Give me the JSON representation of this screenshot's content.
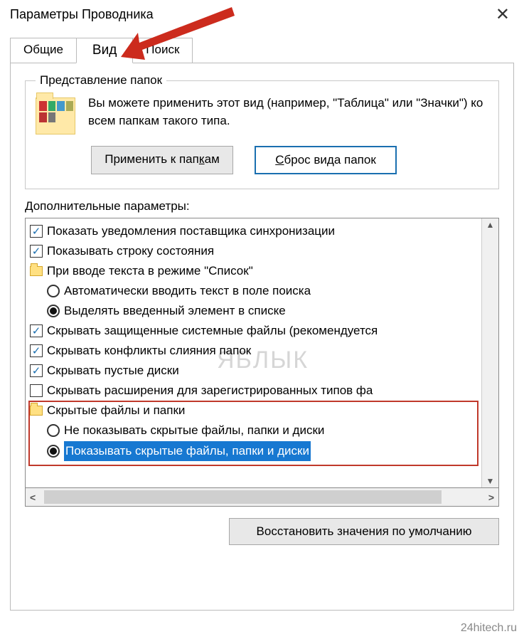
{
  "window": {
    "title": "Параметры Проводника"
  },
  "tabs": {
    "general": "Общие",
    "view": "Вид",
    "search": "Поиск"
  },
  "folder_views": {
    "legend": "Представление папок",
    "desc": "Вы можете применить этот вид (например, \"Таблица\" или \"Значки\") ко всем папкам такого типа.",
    "apply_btn_pre": "Применить к пап",
    "apply_btn_ul": "к",
    "apply_btn_post": "ам",
    "reset_btn_ul": "С",
    "reset_btn_post": "брос вида папок"
  },
  "advanced": {
    "label": "Дополнительные параметры:",
    "items": [
      {
        "type": "check",
        "checked": true,
        "indent": 0,
        "text": "Показать уведомления поставщика синхронизации"
      },
      {
        "type": "check",
        "checked": true,
        "indent": 0,
        "text": "Показывать строку состояния"
      },
      {
        "type": "folder",
        "indent": 0,
        "text": "При вводе текста в режиме \"Список\""
      },
      {
        "type": "radio",
        "selected": false,
        "indent": 1,
        "text": "Автоматически вводить текст в поле поиска"
      },
      {
        "type": "radio",
        "selected": true,
        "indent": 1,
        "text": "Выделять введенный элемент в списке"
      },
      {
        "type": "check",
        "checked": true,
        "indent": 0,
        "text": "Скрывать защищенные системные файлы (рекомендуется"
      },
      {
        "type": "check",
        "checked": true,
        "indent": 0,
        "text": "Скрывать конфликты слияния папок"
      },
      {
        "type": "check",
        "checked": true,
        "indent": 0,
        "text": "Скрывать пустые диски"
      },
      {
        "type": "check",
        "checked": false,
        "indent": 0,
        "text": "Скрывать расширения для зарегистрированных типов фа"
      },
      {
        "type": "folder",
        "indent": 0,
        "text": "Скрытые файлы и папки"
      },
      {
        "type": "radio",
        "selected": false,
        "indent": 1,
        "text": "Не показывать скрытые файлы, папки и диски"
      },
      {
        "type": "radio",
        "selected": true,
        "indent": 1,
        "highlight": true,
        "text": "Показывать скрытые файлы, папки и диски"
      }
    ]
  },
  "restore_btn": "Восстановить значения по умолчанию",
  "watermark": "ЯБЛЫК",
  "attribution": "24hitech.ru"
}
